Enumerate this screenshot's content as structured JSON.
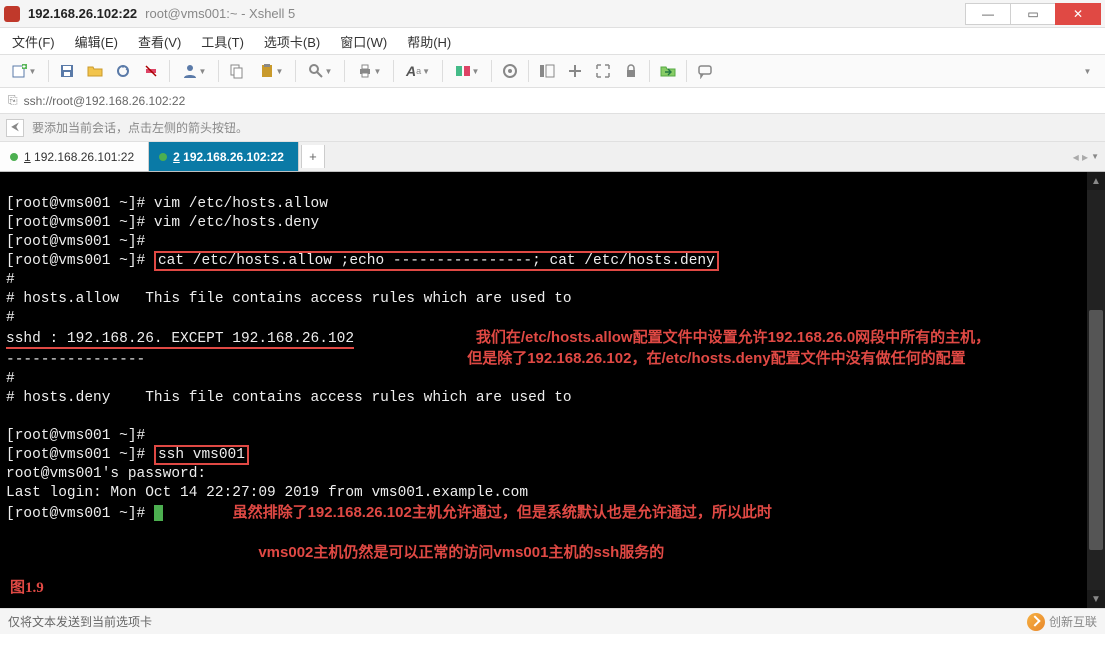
{
  "window": {
    "title_bold": "192.168.26.102:22",
    "title_plain": "root@vms001:~ - Xshell 5"
  },
  "menubar": {
    "file": "文件(F)",
    "edit": "编辑(E)",
    "view": "查看(V)",
    "tools": "工具(T)",
    "tab": "选项卡(B)",
    "window": "窗口(W)",
    "help": "帮助(H)"
  },
  "address": {
    "url": "ssh://root@192.168.26.102:22"
  },
  "hint": {
    "text": "要添加当前会话，点击左侧的箭头按钮。"
  },
  "tabs": {
    "tab1_num": "1",
    "tab1_label": " 192.168.26.101:22",
    "tab2_num": "2",
    "tab2_label": " 192.168.26.102:22"
  },
  "terminal": {
    "l1": "[root@vms001 ~]# vim /etc/hosts.allow",
    "l2": "[root@vms001 ~]# vim /etc/hosts.deny",
    "l3": "[root@vms001 ~]#",
    "l4a": "[root@vms001 ~]# ",
    "l4b": "cat /etc/hosts.allow ;echo ----------------; cat /etc/hosts.deny",
    "l5": "#",
    "l6": "# hosts.allow   This file contains access rules which are used to",
    "l7": "#",
    "l8": "sshd : 192.168.26. EXCEPT 192.168.26.102",
    "note1a": "我们在/etc/hosts.allow配置文件中设置允许192.168.26.0网段中所有的主机，",
    "note1b": "但是除了192.168.26.102，在/etc/hosts.deny配置文件中没有做任何的配置",
    "l9": "----------------",
    "l10": "#",
    "l11": "# hosts.deny    This file contains access rules which are used to",
    "l12": "",
    "l13": "[root@vms001 ~]#",
    "l14a": "[root@vms001 ~]# ",
    "l14b": "ssh vms001",
    "l15": "root@vms001's password:",
    "l16": "Last login: Mon Oct 14 22:27:09 2019 from vms001.example.com",
    "l17": "[root@vms001 ~]# ",
    "note2a": "虽然排除了192.168.26.102主机允许通过，但是系统默认也是允许通过，所以此时",
    "note2b": "vms002主机仍然是可以正常的访问vms001主机的ssh服务的",
    "fig": "图1.9"
  },
  "status": {
    "text": "仅将文本发送到当前选项卡",
    "brand": "创新互联"
  }
}
